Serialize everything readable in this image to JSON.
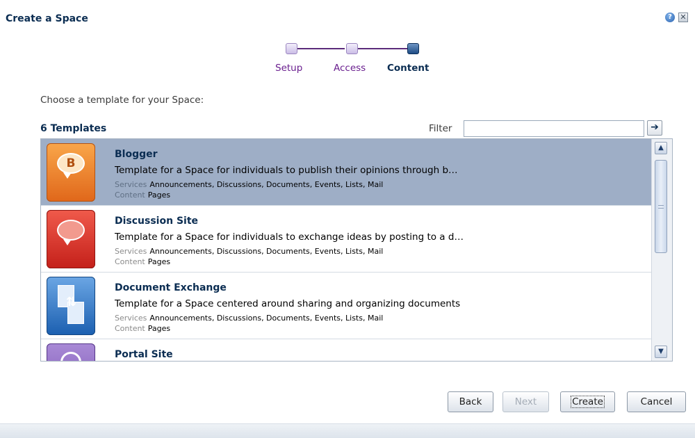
{
  "dialog": {
    "title": "Create a Space",
    "help_icon": "help-icon",
    "close_icon": "close-icon"
  },
  "train": {
    "steps": [
      {
        "label": "Setup",
        "state": "visited"
      },
      {
        "label": "Access",
        "state": "visited"
      },
      {
        "label": "Content",
        "state": "current"
      }
    ]
  },
  "prompt": "Choose a template for your Space:",
  "templates_header": {
    "count_label": "6 Templates",
    "filter_label": "Filter",
    "filter_value": "",
    "go_icon": "arrow-right-icon"
  },
  "templates": [
    {
      "name": "Blogger",
      "description": "Template for a Space for individuals to publish their opinions through b…",
      "services_key": "Services",
      "services": "Announcements, Discussions, Documents, Events, Lists, Mail",
      "content_key": "Content",
      "content": "Pages",
      "icon": "blog-bubble-icon",
      "icon_letter": "B",
      "selected": true
    },
    {
      "name": "Discussion Site",
      "description": "Template for a Space for individuals to exchange ideas by posting to a d…",
      "services_key": "Services",
      "services": "Announcements, Discussions, Documents, Events, Lists, Mail",
      "content_key": "Content",
      "content": "Pages",
      "icon": "discussion-bubble-icon",
      "selected": false
    },
    {
      "name": "Document Exchange",
      "description": "Template for a Space centered around sharing and organizing documents",
      "services_key": "Services",
      "services": "Announcements, Discussions, Documents, Events, Lists, Mail",
      "content_key": "Content",
      "content": "Pages",
      "icon": "document-exchange-icon",
      "selected": false
    },
    {
      "name": "Portal Site",
      "icon": "portal-clock-icon",
      "selected": false
    }
  ],
  "scrollbar": {
    "up_icon": "chevron-up-icon",
    "down_icon": "chevron-down-icon"
  },
  "buttons": {
    "back": "Back",
    "next": "Next",
    "create": "Create",
    "cancel": "Cancel"
  },
  "colors": {
    "title": "#0b2d52",
    "train_visited": "#6a1f8f",
    "selected_row": "#9eaec6"
  }
}
